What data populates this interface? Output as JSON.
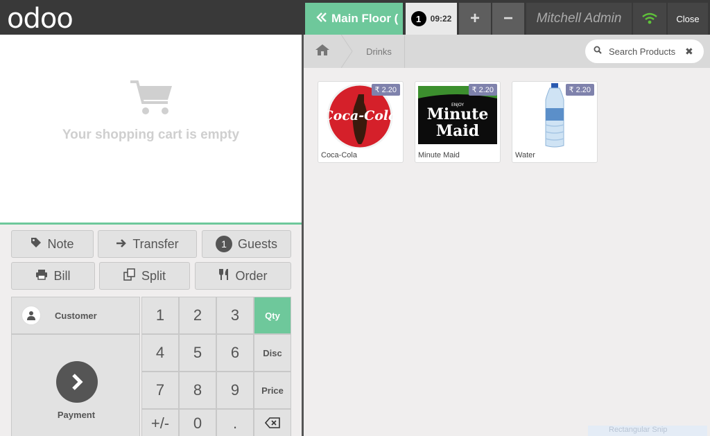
{
  "app": {
    "logo": "odoo"
  },
  "topbar": {
    "floor_label": "Main Floor (",
    "order_count": "1",
    "order_time": "09:22",
    "add_label": "+",
    "remove_label": "−",
    "cashier": "Mitchell Admin",
    "close_label": "Close"
  },
  "cart": {
    "empty_text": "Your shopping cart is empty"
  },
  "control_buttons": {
    "note": "Note",
    "transfer": "Transfer",
    "guests_count": "1",
    "guests": "Guests",
    "bill": "Bill",
    "split": "Split",
    "order": "Order"
  },
  "actionpad": {
    "customer": "Customer",
    "payment": "Payment"
  },
  "numpad": {
    "k1": "1",
    "k2": "2",
    "k3": "3",
    "k4": "4",
    "k5": "5",
    "k6": "6",
    "k7": "7",
    "k8": "8",
    "k9": "9",
    "kpm": "+/-",
    "k0": "0",
    "kdot": ".",
    "qty": "Qty",
    "disc": "Disc",
    "price": "Price"
  },
  "breadcrumb": {
    "category": "Drinks"
  },
  "search": {
    "placeholder": "Search Products"
  },
  "products": [
    {
      "name": "Coca-Cola",
      "price": "₹ 2.20",
      "logo_text": "Coca-Cola"
    },
    {
      "name": "Minute Maid",
      "price": "₹ 2.20",
      "logo_small": "ENJOY",
      "logo_line1": "Minute",
      "logo_line2": "Maid"
    },
    {
      "name": "Water",
      "price": "₹ 2.20"
    }
  ],
  "overlay": {
    "snip_text": "Rectangular Snip"
  },
  "colors": {
    "accent": "#6ec89b",
    "topbar": "#393939",
    "price_tag": "#7f82ac"
  }
}
